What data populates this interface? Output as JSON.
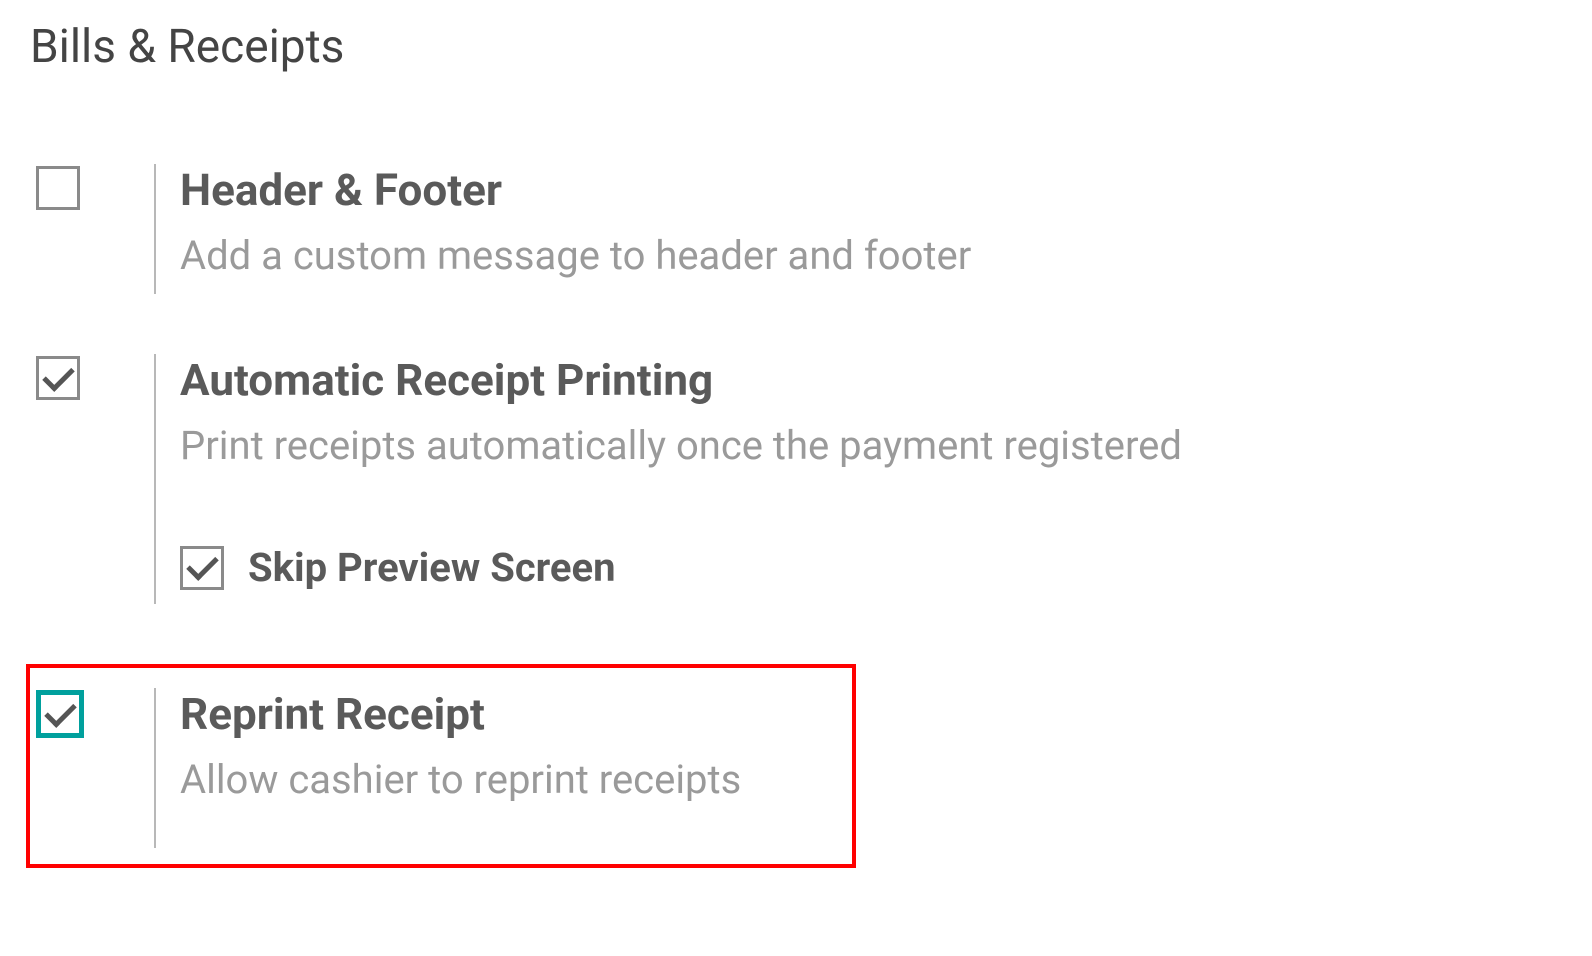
{
  "section": {
    "title": "Bills & Receipts"
  },
  "settings": {
    "header_footer": {
      "title": "Header & Footer",
      "description": "Add a custom message to header and footer",
      "checked": false
    },
    "auto_receipt": {
      "title": "Automatic Receipt Printing",
      "description": "Print receipts automatically once the payment registered",
      "checked": true,
      "skip_preview": {
        "label": "Skip Preview Screen",
        "checked": true
      }
    },
    "reprint_receipt": {
      "title": "Reprint Receipt",
      "description": "Allow cashier to reprint receipts",
      "checked": true
    }
  }
}
